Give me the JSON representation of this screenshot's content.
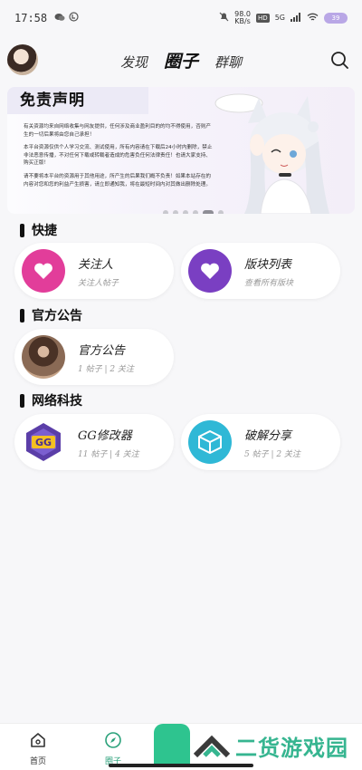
{
  "status": {
    "time": "17:58",
    "net_speed": "98.0 KB/s",
    "hd": "HD",
    "signal": "5G",
    "battery": "39"
  },
  "header": {
    "tabs": [
      {
        "label": "发现",
        "active": false
      },
      {
        "label": "圈子",
        "active": true
      },
      {
        "label": "群聊",
        "active": false
      }
    ]
  },
  "banner": {
    "title": "免责声明",
    "paragraphs": [
      "有关资源均来自网络收集与网友提供，任何涉及商业盈利目的的均不得使用，否则产生的一切后果将由您自己承担！",
      "本平台资源仅供个人学习交流、测试使用，所有内容请在下载后24小时内删除，禁止非法恶意传播，不对任何下载或转载者造成的危害负任何法律责任！也请大家支持、购买正版！",
      "请不要将本平台的资源用于其他用途，所产生的后果我们概不负责！如果本站存在的内容对您和您的利益产生损害，请立即通知我，将在最短时间内对其做出删除处理。"
    ],
    "slide_count": 6,
    "active_slide": 4
  },
  "sections": [
    {
      "title": "快捷",
      "cards": [
        {
          "title": "关注人",
          "subtitle": "关注人帖子",
          "icon": "heart-icon",
          "color": "#e23d9a"
        },
        {
          "title": "版块列表",
          "subtitle": "查看所有版块",
          "icon": "heart-icon",
          "color": "#7a3fc2"
        }
      ]
    },
    {
      "title": "官方公告",
      "cards": [
        {
          "title": "官方公告",
          "subtitle": "1 帖子 | 2 关注",
          "icon": "announcement-avatar"
        }
      ]
    },
    {
      "title": "网络科技",
      "cards": [
        {
          "title": "GG修改器",
          "subtitle": "11 帖子 | 4 关注",
          "icon": "gg-logo-icon"
        },
        {
          "title": "破解分享",
          "subtitle": "5 帖子 | 2 关注",
          "icon": "cube-icon",
          "color": "#2fb8d6"
        }
      ]
    }
  ],
  "bottom_nav": [
    {
      "label": "首页",
      "icon": "home-icon",
      "active": false
    },
    {
      "label": "圈子",
      "icon": "compass-icon",
      "active": true
    }
  ],
  "watermark": "二货游戏园"
}
